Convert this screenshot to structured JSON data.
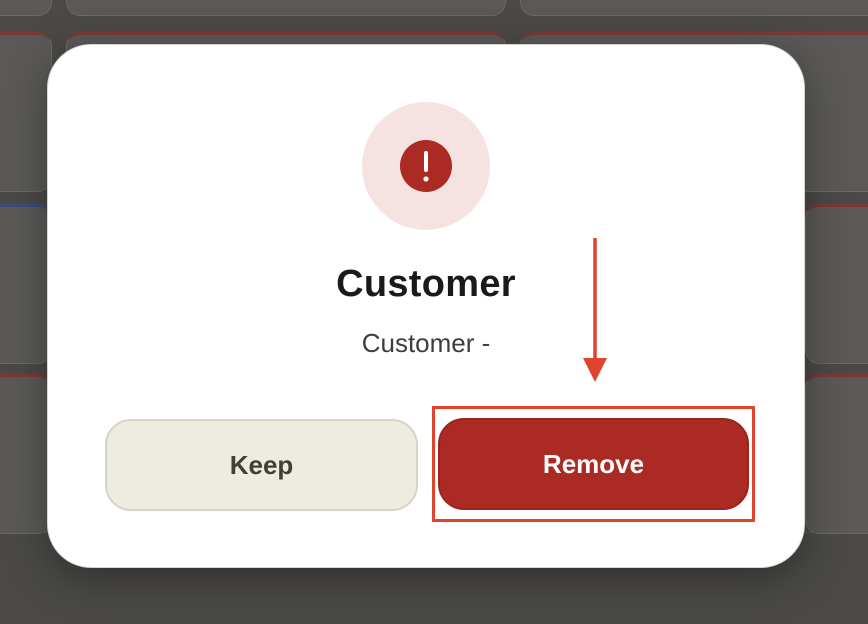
{
  "dialog": {
    "title": "Customer",
    "subtitle": "Customer -",
    "icon": "alert-exclamation-icon",
    "keep_label": "Keep",
    "remove_label": "Remove"
  },
  "colors": {
    "danger": "#ab2b24",
    "danger_soft": "#f6e2e1",
    "neutral_button": "#eeebe1",
    "annotation": "#e0442c"
  }
}
